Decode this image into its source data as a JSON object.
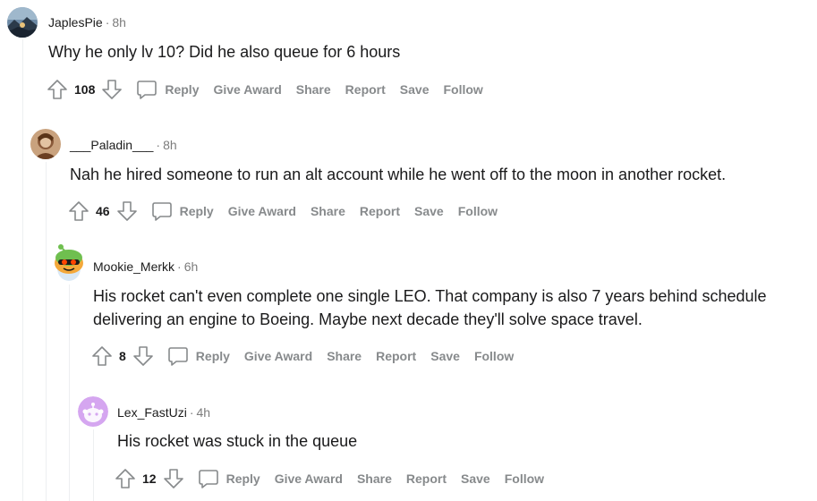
{
  "comments": [
    {
      "author": "JaplesPie",
      "sep": "·",
      "time": "8h",
      "body": "Why he only lv 10? Did he also queue for 6 hours",
      "score": "108"
    },
    {
      "author": "___Paladin___",
      "sep": "·",
      "time": "8h",
      "body": "Nah he hired someone to run an alt account while he went off to the moon in another rocket.",
      "score": "46"
    },
    {
      "author": "Mookie_Merkk",
      "sep": "·",
      "time": "6h",
      "body_line1": "His rocket can't even complete one single LEO. That company is also 7 years behind schedule",
      "body_line2": "delivering an engine to Boeing. Maybe next decade they'll solve space travel.",
      "score": "8"
    },
    {
      "author": "Lex_FastUzi",
      "sep": "·",
      "time": "4h",
      "body": "His rocket was stuck in the queue",
      "score": "12"
    }
  ],
  "actions": {
    "reply": "Reply",
    "give_award": "Give Award",
    "share": "Share",
    "report": "Report",
    "save": "Save",
    "follow": "Follow"
  },
  "colors": {
    "action_gray": "#878a8c",
    "thread_line": "#edeff1",
    "meta_gray": "#7c7c7c"
  }
}
